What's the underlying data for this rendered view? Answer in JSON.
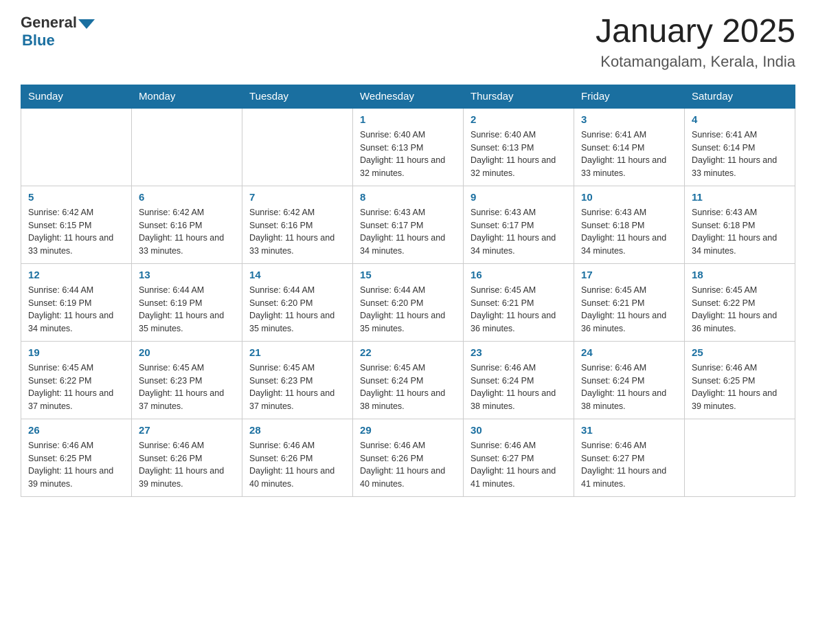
{
  "header": {
    "logo_text_general": "General",
    "logo_text_blue": "Blue",
    "month_title": "January 2025",
    "location": "Kotamangalam, Kerala, India"
  },
  "days_of_week": [
    "Sunday",
    "Monday",
    "Tuesday",
    "Wednesday",
    "Thursday",
    "Friday",
    "Saturday"
  ],
  "weeks": [
    [
      {
        "day": "",
        "sunrise": "",
        "sunset": "",
        "daylight": ""
      },
      {
        "day": "",
        "sunrise": "",
        "sunset": "",
        "daylight": ""
      },
      {
        "day": "",
        "sunrise": "",
        "sunset": "",
        "daylight": ""
      },
      {
        "day": "1",
        "sunrise": "Sunrise: 6:40 AM",
        "sunset": "Sunset: 6:13 PM",
        "daylight": "Daylight: 11 hours and 32 minutes."
      },
      {
        "day": "2",
        "sunrise": "Sunrise: 6:40 AM",
        "sunset": "Sunset: 6:13 PM",
        "daylight": "Daylight: 11 hours and 32 minutes."
      },
      {
        "day": "3",
        "sunrise": "Sunrise: 6:41 AM",
        "sunset": "Sunset: 6:14 PM",
        "daylight": "Daylight: 11 hours and 33 minutes."
      },
      {
        "day": "4",
        "sunrise": "Sunrise: 6:41 AM",
        "sunset": "Sunset: 6:14 PM",
        "daylight": "Daylight: 11 hours and 33 minutes."
      }
    ],
    [
      {
        "day": "5",
        "sunrise": "Sunrise: 6:42 AM",
        "sunset": "Sunset: 6:15 PM",
        "daylight": "Daylight: 11 hours and 33 minutes."
      },
      {
        "day": "6",
        "sunrise": "Sunrise: 6:42 AM",
        "sunset": "Sunset: 6:16 PM",
        "daylight": "Daylight: 11 hours and 33 minutes."
      },
      {
        "day": "7",
        "sunrise": "Sunrise: 6:42 AM",
        "sunset": "Sunset: 6:16 PM",
        "daylight": "Daylight: 11 hours and 33 minutes."
      },
      {
        "day": "8",
        "sunrise": "Sunrise: 6:43 AM",
        "sunset": "Sunset: 6:17 PM",
        "daylight": "Daylight: 11 hours and 34 minutes."
      },
      {
        "day": "9",
        "sunrise": "Sunrise: 6:43 AM",
        "sunset": "Sunset: 6:17 PM",
        "daylight": "Daylight: 11 hours and 34 minutes."
      },
      {
        "day": "10",
        "sunrise": "Sunrise: 6:43 AM",
        "sunset": "Sunset: 6:18 PM",
        "daylight": "Daylight: 11 hours and 34 minutes."
      },
      {
        "day": "11",
        "sunrise": "Sunrise: 6:43 AM",
        "sunset": "Sunset: 6:18 PM",
        "daylight": "Daylight: 11 hours and 34 minutes."
      }
    ],
    [
      {
        "day": "12",
        "sunrise": "Sunrise: 6:44 AM",
        "sunset": "Sunset: 6:19 PM",
        "daylight": "Daylight: 11 hours and 34 minutes."
      },
      {
        "day": "13",
        "sunrise": "Sunrise: 6:44 AM",
        "sunset": "Sunset: 6:19 PM",
        "daylight": "Daylight: 11 hours and 35 minutes."
      },
      {
        "day": "14",
        "sunrise": "Sunrise: 6:44 AM",
        "sunset": "Sunset: 6:20 PM",
        "daylight": "Daylight: 11 hours and 35 minutes."
      },
      {
        "day": "15",
        "sunrise": "Sunrise: 6:44 AM",
        "sunset": "Sunset: 6:20 PM",
        "daylight": "Daylight: 11 hours and 35 minutes."
      },
      {
        "day": "16",
        "sunrise": "Sunrise: 6:45 AM",
        "sunset": "Sunset: 6:21 PM",
        "daylight": "Daylight: 11 hours and 36 minutes."
      },
      {
        "day": "17",
        "sunrise": "Sunrise: 6:45 AM",
        "sunset": "Sunset: 6:21 PM",
        "daylight": "Daylight: 11 hours and 36 minutes."
      },
      {
        "day": "18",
        "sunrise": "Sunrise: 6:45 AM",
        "sunset": "Sunset: 6:22 PM",
        "daylight": "Daylight: 11 hours and 36 minutes."
      }
    ],
    [
      {
        "day": "19",
        "sunrise": "Sunrise: 6:45 AM",
        "sunset": "Sunset: 6:22 PM",
        "daylight": "Daylight: 11 hours and 37 minutes."
      },
      {
        "day": "20",
        "sunrise": "Sunrise: 6:45 AM",
        "sunset": "Sunset: 6:23 PM",
        "daylight": "Daylight: 11 hours and 37 minutes."
      },
      {
        "day": "21",
        "sunrise": "Sunrise: 6:45 AM",
        "sunset": "Sunset: 6:23 PM",
        "daylight": "Daylight: 11 hours and 37 minutes."
      },
      {
        "day": "22",
        "sunrise": "Sunrise: 6:45 AM",
        "sunset": "Sunset: 6:24 PM",
        "daylight": "Daylight: 11 hours and 38 minutes."
      },
      {
        "day": "23",
        "sunrise": "Sunrise: 6:46 AM",
        "sunset": "Sunset: 6:24 PM",
        "daylight": "Daylight: 11 hours and 38 minutes."
      },
      {
        "day": "24",
        "sunrise": "Sunrise: 6:46 AM",
        "sunset": "Sunset: 6:24 PM",
        "daylight": "Daylight: 11 hours and 38 minutes."
      },
      {
        "day": "25",
        "sunrise": "Sunrise: 6:46 AM",
        "sunset": "Sunset: 6:25 PM",
        "daylight": "Daylight: 11 hours and 39 minutes."
      }
    ],
    [
      {
        "day": "26",
        "sunrise": "Sunrise: 6:46 AM",
        "sunset": "Sunset: 6:25 PM",
        "daylight": "Daylight: 11 hours and 39 minutes."
      },
      {
        "day": "27",
        "sunrise": "Sunrise: 6:46 AM",
        "sunset": "Sunset: 6:26 PM",
        "daylight": "Daylight: 11 hours and 39 minutes."
      },
      {
        "day": "28",
        "sunrise": "Sunrise: 6:46 AM",
        "sunset": "Sunset: 6:26 PM",
        "daylight": "Daylight: 11 hours and 40 minutes."
      },
      {
        "day": "29",
        "sunrise": "Sunrise: 6:46 AM",
        "sunset": "Sunset: 6:26 PM",
        "daylight": "Daylight: 11 hours and 40 minutes."
      },
      {
        "day": "30",
        "sunrise": "Sunrise: 6:46 AM",
        "sunset": "Sunset: 6:27 PM",
        "daylight": "Daylight: 11 hours and 41 minutes."
      },
      {
        "day": "31",
        "sunrise": "Sunrise: 6:46 AM",
        "sunset": "Sunset: 6:27 PM",
        "daylight": "Daylight: 11 hours and 41 minutes."
      },
      {
        "day": "",
        "sunrise": "",
        "sunset": "",
        "daylight": ""
      }
    ]
  ]
}
